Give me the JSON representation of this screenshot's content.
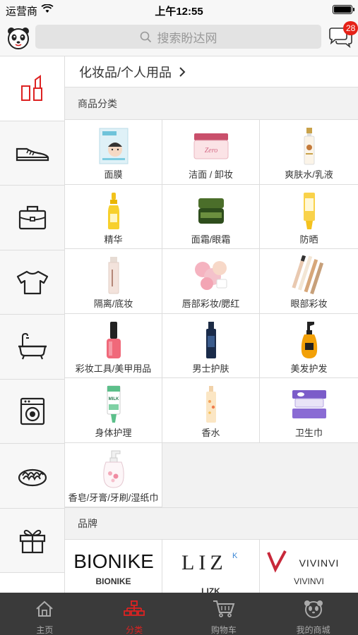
{
  "status": {
    "carrier": "运营商",
    "time": "上午12:55"
  },
  "header": {
    "search_placeholder": "搜索盼达网",
    "message_count": "28"
  },
  "category": {
    "title": "化妆品/个人用品"
  },
  "sections": {
    "goods": "商品分类",
    "brands": "品牌"
  },
  "sidebar": [
    {
      "icon": "lipstick-icon",
      "active": true
    },
    {
      "icon": "shoe-icon"
    },
    {
      "icon": "briefcase-icon"
    },
    {
      "icon": "tshirt-icon"
    },
    {
      "icon": "bathtub-icon"
    },
    {
      "icon": "washing-machine-icon"
    },
    {
      "icon": "noodles-icon"
    },
    {
      "icon": "gift-icon"
    }
  ],
  "products": [
    {
      "label": "面膜",
      "icon": "face-mask-image"
    },
    {
      "label": "洁面 / 卸妆",
      "icon": "cleansing-cream-image"
    },
    {
      "label": "爽肤水/乳液",
      "icon": "toner-bottle-image"
    },
    {
      "label": "精华",
      "icon": "serum-bottle-image"
    },
    {
      "label": "面霜/眼霜",
      "icon": "cream-jar-image"
    },
    {
      "label": "防晒",
      "icon": "sunscreen-image"
    },
    {
      "label": "隔离/底妆",
      "icon": "foundation-tube-image"
    },
    {
      "label": "唇部彩妆/腮红",
      "icon": "blush-palette-image"
    },
    {
      "label": "眼部彩妆",
      "icon": "mascara-image"
    },
    {
      "label": "彩妆工具/美甲用品",
      "icon": "nail-polish-image"
    },
    {
      "label": "男士护肤",
      "icon": "mens-skincare-image"
    },
    {
      "label": "美发护发",
      "icon": "hair-oil-image"
    },
    {
      "label": "身体护理",
      "icon": "body-lotion-image"
    },
    {
      "label": "香水",
      "icon": "perfume-image"
    },
    {
      "label": "卫生巾",
      "icon": "sanitary-pads-image"
    },
    {
      "label": "香皂/牙膏/牙刷/湿纸巾",
      "icon": "hand-soap-image"
    }
  ],
  "brands": [
    {
      "logo": "BIONIKE",
      "name": "BIONIKE"
    },
    {
      "logo": "LIZK",
      "name": "LIZK"
    },
    {
      "logo": "VIVINVI",
      "name": "VIVINVI"
    }
  ],
  "tabs": [
    {
      "label": "主页",
      "icon": "home-icon"
    },
    {
      "label": "分类",
      "icon": "category-icon",
      "active": true
    },
    {
      "label": "购物车",
      "icon": "cart-icon"
    },
    {
      "label": "我的商城",
      "icon": "panda-icon"
    }
  ],
  "colors": {
    "accent": "#d22222",
    "tabbar": "#3a3a3a",
    "badge": "#e62117"
  }
}
